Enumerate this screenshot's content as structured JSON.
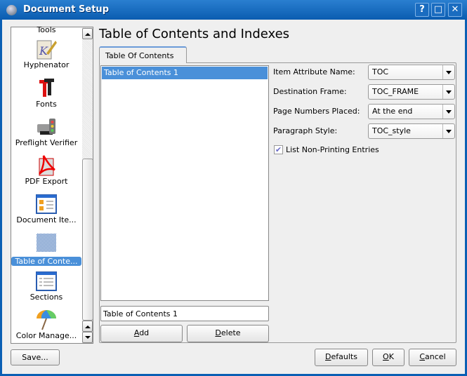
{
  "window": {
    "title": "Document Setup",
    "buttons": [
      "?",
      "□",
      "✕"
    ]
  },
  "sidebar": {
    "items": [
      {
        "label": "Tools",
        "icon": "tools-icon"
      },
      {
        "label": "Hyphenator",
        "icon": "hyphenator-icon"
      },
      {
        "label": "Fonts",
        "icon": "fonts-icon"
      },
      {
        "label": "Preflight Verifier",
        "icon": "preflight-icon"
      },
      {
        "label": "PDF Export",
        "icon": "pdf-icon"
      },
      {
        "label": "Document Ite...",
        "icon": "document-items-icon"
      },
      {
        "label": "Table of Conte...",
        "icon": "toc-icon",
        "selected": true
      },
      {
        "label": "Sections",
        "icon": "sections-icon"
      },
      {
        "label": "Color Manage...",
        "icon": "color-management-icon"
      }
    ]
  },
  "main": {
    "heading": "Table of Contents and Indexes",
    "tab": "Table Of Contents",
    "list": [
      "Table of Contents 1"
    ],
    "name_input": "Table of Contents 1",
    "add": {
      "key": "A",
      "rest": "dd"
    },
    "delete": {
      "key": "D",
      "rest": "elete"
    },
    "fields": [
      {
        "label": "Item Attribute Name:",
        "value": "TOC"
      },
      {
        "label": "Destination Frame:",
        "value": "TOC_FRAME"
      },
      {
        "label": "Page Numbers Placed:",
        "value": "At the end"
      },
      {
        "label": "Paragraph Style:",
        "value": "TOC_style"
      }
    ],
    "checkbox": {
      "label": "List Non-Printing Entries",
      "checked": true
    }
  },
  "footer": {
    "save": "Save...",
    "defaults": {
      "key": "D",
      "rest": "efaults"
    },
    "ok": {
      "key": "O",
      "rest": "K"
    },
    "cancel": {
      "key": "C",
      "rest": "ancel"
    }
  },
  "colors": {
    "titlebar": "#0a5cb0",
    "selection": "#4a90d9"
  }
}
